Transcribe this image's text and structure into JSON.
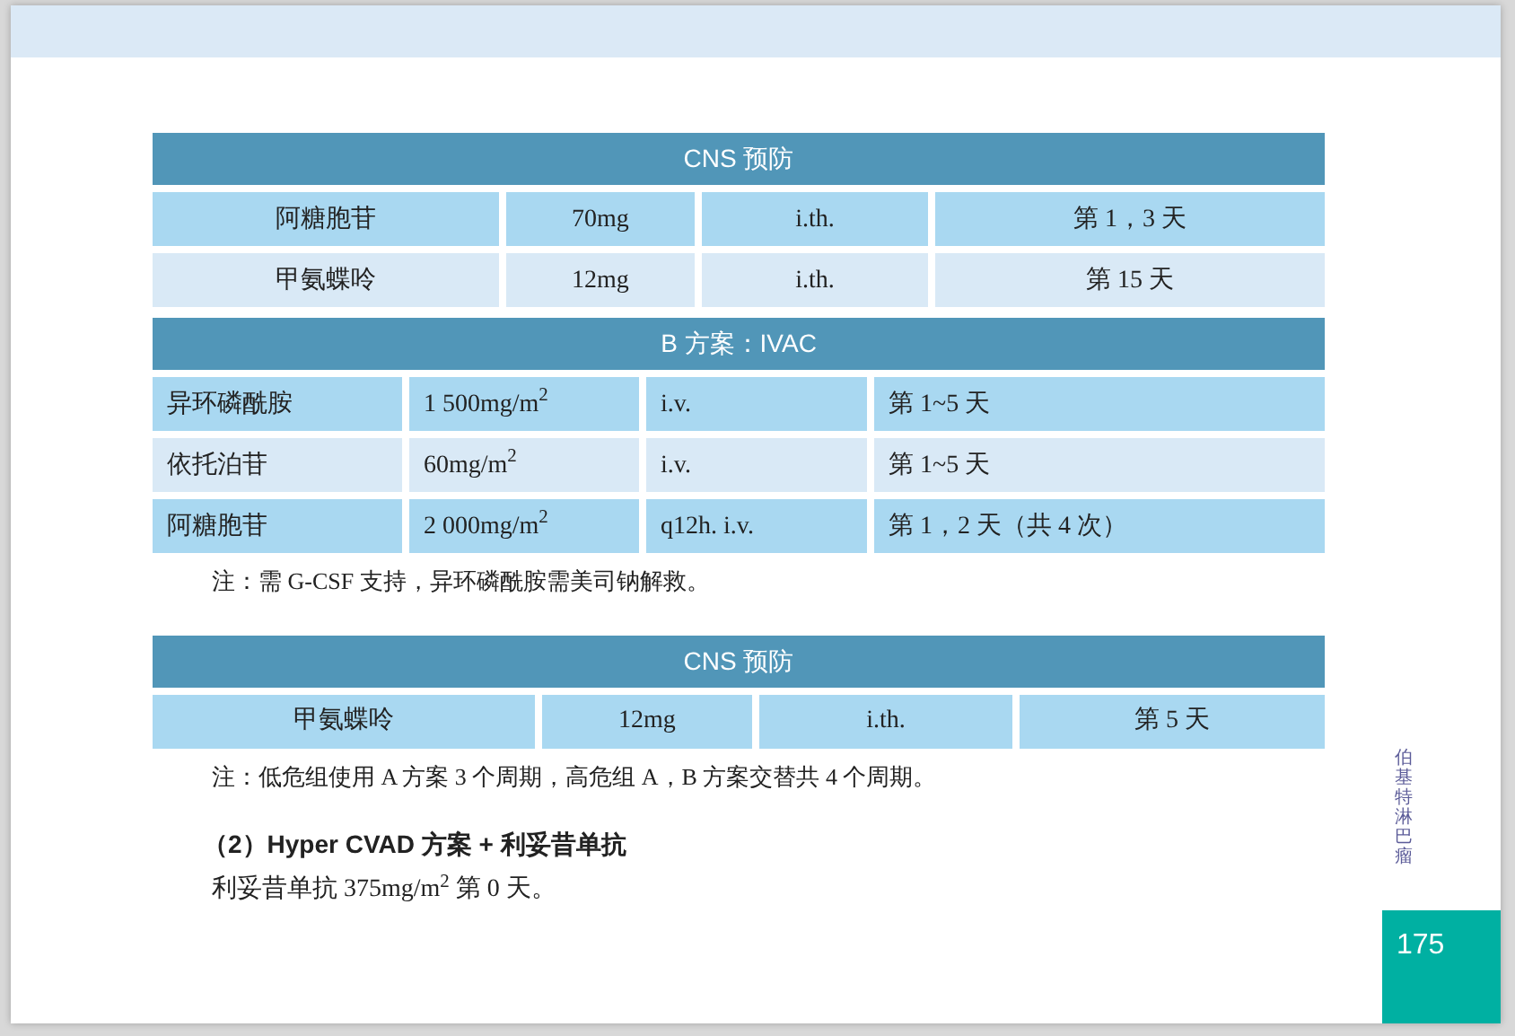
{
  "sections": [
    {
      "kind": "centered_table",
      "title": "CNS 预防",
      "rows": [
        {
          "shaded": true,
          "cells": [
            "阿糖胞苷",
            "70mg",
            "i.th.",
            "第 1，3 天"
          ]
        },
        {
          "shaded": false,
          "cells": [
            "甲氨蝶呤",
            "12mg",
            "i.th.",
            "第 15 天"
          ]
        }
      ]
    },
    {
      "kind": "left_table",
      "title": "B 方案：IVAC",
      "rows": [
        {
          "shaded": true,
          "cells": [
            "异环磷酰胺",
            "1 500mg/m$^{2}$",
            "i.v.",
            "第 1~5 天"
          ]
        },
        {
          "shaded": false,
          "cells": [
            "依托泊苷",
            "60mg/m$^{2}$",
            "i.v.",
            "第 1~5 天"
          ]
        },
        {
          "shaded": true,
          "cells": [
            "阿糖胞苷",
            "2 000mg/m$^{2}$",
            "q12h. i.v.",
            "第 1，2 天（共 4 次）"
          ]
        }
      ]
    },
    {
      "kind": "note",
      "text": "注：需 G-CSF 支持，异环磷酰胺需美司钠解救。"
    },
    {
      "kind": "centered_table",
      "title": "CNS 预防",
      "rows": [
        {
          "shaded": true,
          "cells": [
            "甲氨蝶呤",
            "12mg",
            "i.th.",
            "第 5 天"
          ]
        }
      ]
    },
    {
      "kind": "note",
      "text": "注：低危组使用 A 方案 3 个周期，高危组 A，B 方案交替共 4 个周期。"
    },
    {
      "kind": "heading",
      "text": "（2）Hyper CVAD 方案 + 利妥昔单抗"
    },
    {
      "kind": "body",
      "text": "利妥昔单抗 375mg/m$^{2}$ 第 0 天。"
    }
  ],
  "side_label": "伯基特淋巴瘤",
  "page_number": "175"
}
